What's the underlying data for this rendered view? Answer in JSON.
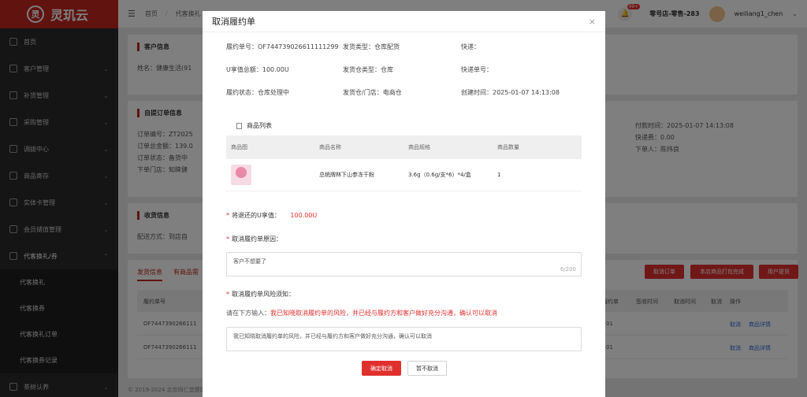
{
  "app": {
    "logo_text": "灵玑云",
    "logo_mark": "灵"
  },
  "sidebar": {
    "items": [
      {
        "label": "首页",
        "icon": "grid-icon",
        "chev": ""
      },
      {
        "label": "客户管理",
        "icon": "customer-icon",
        "chev": "⌄"
      },
      {
        "label": "补货管理",
        "icon": "replenish-icon",
        "chev": "⌄"
      },
      {
        "label": "采购管理",
        "icon": "purchase-icon",
        "chev": "⌄"
      },
      {
        "label": "调拨中心",
        "icon": "transfer-icon",
        "chev": "⌄"
      },
      {
        "label": "商品寄存",
        "icon": "storage-icon",
        "chev": "⌄"
      },
      {
        "label": "实体卡管理",
        "icon": "card-icon",
        "chev": "⌄"
      },
      {
        "label": "会员储值管理",
        "icon": "member-icon",
        "chev": "⌄"
      },
      {
        "label": "代客换礼/券",
        "icon": "cart-icon",
        "chev": "⌃"
      }
    ],
    "sub_items": [
      "代客换礼",
      "代客换券",
      "代客换礼订单",
      "代客换券记录"
    ],
    "last_item": {
      "label": "茶树认养",
      "chev": "⌄"
    }
  },
  "topbar": {
    "breadcrumb": [
      "首页",
      "/",
      "代客换礼"
    ],
    "badge": "99+",
    "store": "零号店-零售-283",
    "user": "weiliang1_chen",
    "user_chev": "⌄"
  },
  "background": {
    "customer_title": "客户信息",
    "customer_name": "姓名：健康生活(91",
    "order_title": "自提订单信息",
    "order_rows": [
      "订单编号：ZT2025",
      "订单总金额：139.0",
      "订单状态：备货中",
      "下单门店：知睐健"
    ],
    "order_right": [
      "付款时间：2025-01-07 14:13:08",
      "快递费：0.00",
      "下单人：陈炜良"
    ],
    "receive_title": "收货信息",
    "receive_row": "配送方式：到店自",
    "tabs": [
      "发货信息",
      "有商品需"
    ],
    "buttons": [
      "取消订单",
      "本店商品打包完成",
      "用户提货"
    ],
    "table_headers": [
      "履约单号",
      "履约单",
      "签收时间",
      "取消时间",
      "取消",
      "操作"
    ],
    "table_rows": [
      {
        "no": "OF7447390266111",
        "ops": [
          "取消",
          "商品详情"
        ],
        "code": "01"
      },
      {
        "no": "OF7447390266111",
        "ops": [
          "取消",
          "商品详情"
        ],
        "code": "01"
      }
    ],
    "footer": "© 2019-2024 北京同仁堂健康"
  },
  "modal": {
    "title": "取消履约单",
    "close": "×",
    "info": [
      {
        "label": "履约单号：",
        "value": "OF744739026611111299"
      },
      {
        "label": "发货类型：",
        "value": "仓库配货"
      },
      {
        "label": "快递：",
        "value": ""
      },
      {
        "label": "U享值总额：",
        "value": "100.00U"
      },
      {
        "label": "发货仓类型：",
        "value": "仓库"
      },
      {
        "label": "快递单号：",
        "value": ""
      },
      {
        "label": "履约状态：",
        "value": "仓库处理中"
      },
      {
        "label": "发货仓/门店：",
        "value": "电商仓"
      },
      {
        "label": "创建时间：",
        "value": "2025-01-07 14:13:08"
      }
    ],
    "product_list_title": "商品列表",
    "table_headers": [
      "商品图",
      "商品名称",
      "商品规格",
      "商品数量"
    ],
    "products": [
      {
        "name": "总统牌林下山参冻干粉",
        "spec": "3.6g（0.6g/支*6）*4/盒",
        "qty": "1"
      }
    ],
    "refund_label": "将退还的U享值：",
    "refund_value": "100.00U",
    "reason_label": "取消履约单原因：",
    "reason_value": "客户不想要了",
    "reason_count": "6/200",
    "risk_label": "取消履约单风险须知：",
    "risk_prompt_prefix": "请在下方输入：",
    "risk_prompt_text": "我已知晓取消履约单的风险，并已经与履约方和客户做好充分沟通，确认可以取消",
    "risk_input_value": "我已知晓取消履约单的风险，并已经与履约方和客户做好充分沟通，确认可以取消",
    "confirm_label": "确定取消",
    "cancel_label": "暂不取消"
  },
  "colors": {
    "accent": "#e0302e",
    "sidebar_bg": "#2b2b2b",
    "logo_bg": "#c2261f"
  }
}
